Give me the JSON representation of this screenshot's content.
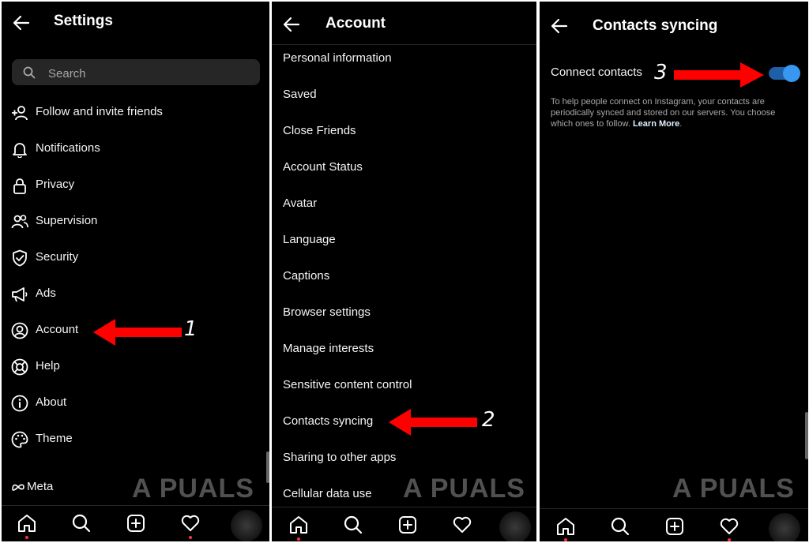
{
  "panel1": {
    "title": "Settings",
    "search_placeholder": "Search",
    "items": [
      {
        "label": "Follow and invite friends",
        "icon": "add-person-icon"
      },
      {
        "label": "Notifications",
        "icon": "bell-icon"
      },
      {
        "label": "Privacy",
        "icon": "lock-icon"
      },
      {
        "label": "Supervision",
        "icon": "people-icon"
      },
      {
        "label": "Security",
        "icon": "shield-icon"
      },
      {
        "label": "Ads",
        "icon": "megaphone-icon"
      },
      {
        "label": "Account",
        "icon": "user-circle-icon"
      },
      {
        "label": "Help",
        "icon": "lifebuoy-icon"
      },
      {
        "label": "About",
        "icon": "info-icon"
      },
      {
        "label": "Theme",
        "icon": "palette-icon"
      }
    ],
    "meta_label": "Meta",
    "step_number": "1"
  },
  "panel2": {
    "title": "Account",
    "items": [
      {
        "label": "Personal information"
      },
      {
        "label": "Saved"
      },
      {
        "label": "Close Friends"
      },
      {
        "label": "Account Status"
      },
      {
        "label": "Avatar"
      },
      {
        "label": "Language"
      },
      {
        "label": "Captions"
      },
      {
        "label": "Browser settings"
      },
      {
        "label": "Manage interests"
      },
      {
        "label": "Sensitive content control"
      },
      {
        "label": "Contacts syncing"
      },
      {
        "label": "Sharing to other apps"
      },
      {
        "label": "Cellular data use"
      }
    ],
    "step_number": "2"
  },
  "panel3": {
    "title": "Contacts syncing",
    "connect_label": "Connect contacts",
    "toggle_on": true,
    "description": "To help people connect on Instagram, your contacts are periodically synced and stored on our servers. You choose which ones to follow.",
    "learn_more": "Learn More",
    "step_number": "3"
  },
  "watermark": "A PUALS",
  "colors": {
    "background": "#000000",
    "accent": "#3897f0",
    "arrow": "#ff0000",
    "notification_dot": "#ff3040"
  },
  "nav_icons": [
    "home-icon",
    "search-icon",
    "create-icon",
    "heart-icon",
    "profile-avatar"
  ]
}
